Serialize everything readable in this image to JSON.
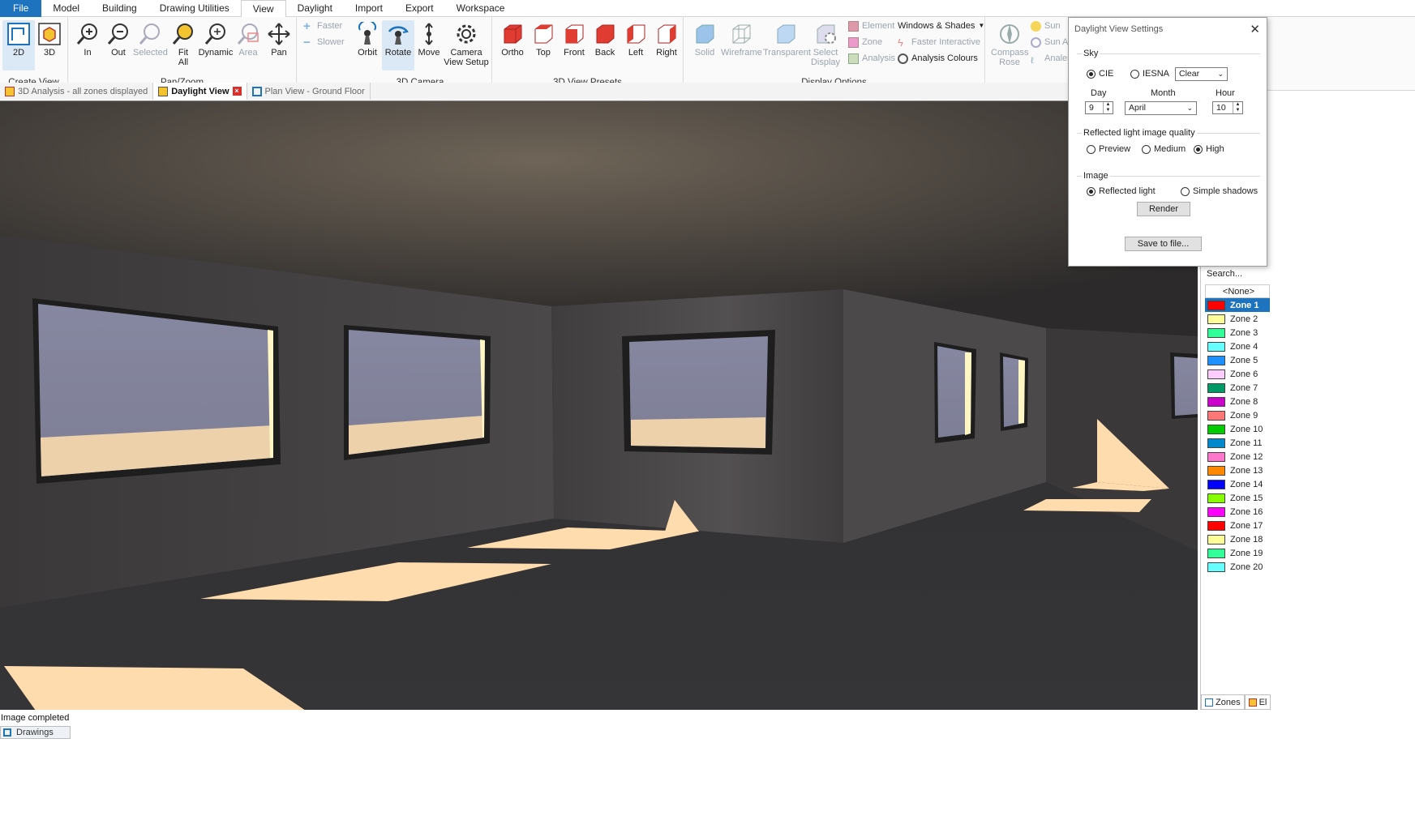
{
  "menu": [
    "File",
    "Model",
    "Building",
    "Drawing Utilities",
    "View",
    "Daylight",
    "Import",
    "Export",
    "Workspace"
  ],
  "ribbon": {
    "create_view": {
      "label": "Create View",
      "b2d": "2D",
      "b3d": "3D"
    },
    "pan_zoom": {
      "label": "Pan/Zoom",
      "in": "In",
      "out": "Out",
      "selected": "Selected",
      "fit_all_1": "Fit",
      "fit_all_2": "All",
      "dynamic": "Dynamic",
      "area": "Area",
      "pan": "Pan",
      "faster": "Faster",
      "slower": "Slower"
    },
    "camera": {
      "label": "3D Camera",
      "orbit": "Orbit",
      "rotate": "Rotate",
      "move": "Move",
      "setup_1": "Camera",
      "setup_2": "View Setup"
    },
    "presets": {
      "label": "3D View Presets",
      "ortho": "Ortho",
      "top": "Top",
      "front": "Front",
      "back": "Back",
      "left": "Left",
      "right": "Right"
    },
    "display": {
      "label": "Display Options",
      "solid": "Solid",
      "wireframe": "Wireframe",
      "transparent": "Transparent",
      "select_1": "Select",
      "select_2": "Display",
      "element": "Element",
      "zone": "Zone",
      "analysis": "Analysis",
      "windows_shades": "Windows & Shades",
      "faster_interactive": "Faster Interactive",
      "analysis_colours": "Analysis Colours"
    },
    "sun": {
      "compass_1": "Compass",
      "compass_2": "Rose",
      "sun": "Sun",
      "sun_a": "Sun A",
      "analer": "Analer"
    }
  },
  "doc_tabs": [
    "3D Analysis - all zones displayed",
    "Daylight View",
    "Plan View - Ground Floor"
  ],
  "dialog": {
    "title": "Daylight View Settings",
    "sky_label": "Sky",
    "cie": "CIE",
    "iesna": "IESNA",
    "sky_type": "Clear",
    "day_label": "Day",
    "month_label": "Month",
    "hour_label": "Hour",
    "day": "9",
    "month": "April",
    "hour": "10",
    "quality_label": "Reflected light image quality",
    "preview": "Preview",
    "medium": "Medium",
    "high": "High",
    "image_label": "Image",
    "reflected": "Reflected light",
    "shadows": "Simple shadows",
    "render": "Render",
    "save": "Save to file..."
  },
  "zones_panel": {
    "search": "Search...",
    "none": "<None>",
    "zones": [
      {
        "name": "Zone 1",
        "color": "#ff0000"
      },
      {
        "name": "Zone 2",
        "color": "#ffff99"
      },
      {
        "name": "Zone 3",
        "color": "#33ff99"
      },
      {
        "name": "Zone 4",
        "color": "#66ffff"
      },
      {
        "name": "Zone 5",
        "color": "#1e90ff"
      },
      {
        "name": "Zone 6",
        "color": "#ffccff"
      },
      {
        "name": "Zone 7",
        "color": "#009966"
      },
      {
        "name": "Zone 8",
        "color": "#cc00cc"
      },
      {
        "name": "Zone 9",
        "color": "#ff7777"
      },
      {
        "name": "Zone 10",
        "color": "#00cc00"
      },
      {
        "name": "Zone 11",
        "color": "#0088cc"
      },
      {
        "name": "Zone 12",
        "color": "#ff77cc"
      },
      {
        "name": "Zone 13",
        "color": "#ff8800"
      },
      {
        "name": "Zone 14",
        "color": "#0000ff"
      },
      {
        "name": "Zone 15",
        "color": "#88ff00"
      },
      {
        "name": "Zone 16",
        "color": "#ff00ff"
      },
      {
        "name": "Zone 17",
        "color": "#ff0000"
      },
      {
        "name": "Zone 18",
        "color": "#ffff99"
      },
      {
        "name": "Zone 19",
        "color": "#33ff99"
      },
      {
        "name": "Zone 20",
        "color": "#66ffff"
      }
    ],
    "tab_zones": "Zones",
    "tab_el": "El"
  },
  "status": "Image completed",
  "bottom_tab": "Drawings",
  "colors": {
    "accent": "#1e73be",
    "floor": "#2e2e30",
    "light_patch": "#ffdcae",
    "sky": "#8a8aa5"
  }
}
